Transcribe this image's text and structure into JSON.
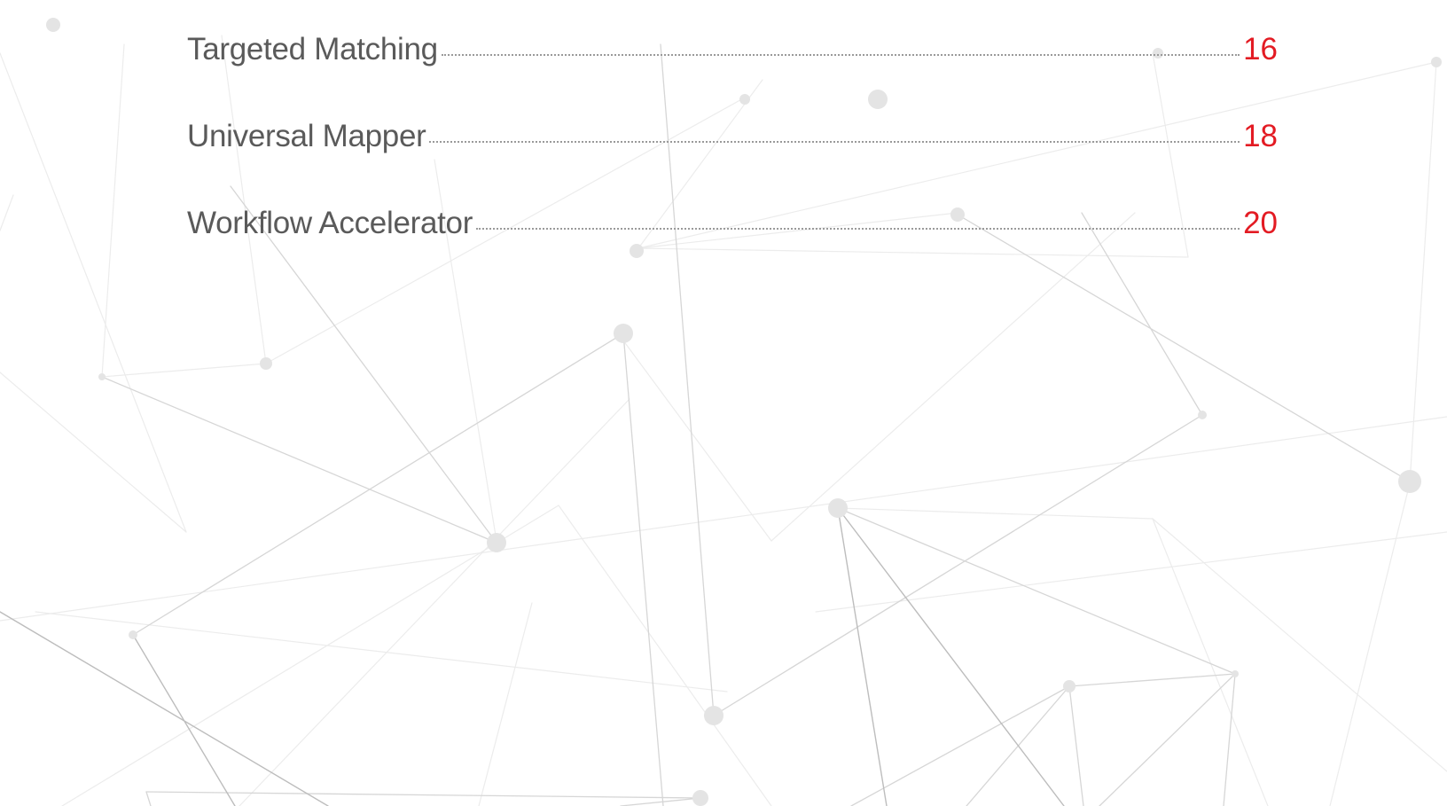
{
  "toc": {
    "entries": [
      {
        "title": "Targeted Matching",
        "page": "16"
      },
      {
        "title": "Universal Mapper",
        "page": "18"
      },
      {
        "title": "Workflow Accelerator",
        "page": "20"
      }
    ]
  },
  "colors": {
    "text": "#5a5a5a",
    "page_number": "#e31b23",
    "leader": "#9a9a9a",
    "network_lines": "#c8c8c8",
    "network_nodes": "#e4e4e4"
  },
  "background": {
    "pattern": "network-mesh"
  }
}
